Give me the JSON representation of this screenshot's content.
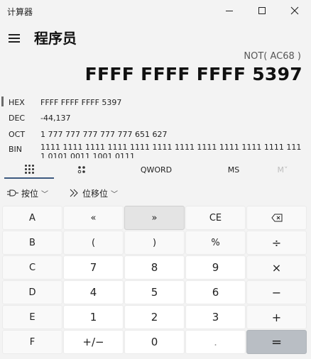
{
  "window": {
    "title": "计算器"
  },
  "header": {
    "mode": "程序员"
  },
  "display": {
    "expression": "NOT( AC68 )",
    "value": "FFFF FFFF FFFF 5397"
  },
  "radix": [
    {
      "label": "HEX",
      "value": "FFFF FFFF FFFF 5397"
    },
    {
      "label": "DEC",
      "value": "-44,137"
    },
    {
      "label": "OCT",
      "value": "1 777 777 777 777 777 651 627"
    },
    {
      "label": "BIN",
      "value": "1111 1111 1111 1111 1111 1111 1111 1111 1111 1111 1111 1111 0101 0011 1001 0111"
    }
  ],
  "tabs": {
    "word_size": "QWORD",
    "memory_store": "MS",
    "memory_add": "M˅"
  },
  "operations": {
    "bitwise": "按位",
    "bit_shift": "位移位"
  },
  "keypad": [
    [
      "A",
      "«",
      "»",
      "CE",
      "⌫"
    ],
    [
      "B",
      "(",
      ")",
      "%",
      "÷"
    ],
    [
      "C",
      "7",
      "8",
      "9",
      "×"
    ],
    [
      "D",
      "4",
      "5",
      "6",
      "−"
    ],
    [
      "E",
      "1",
      "2",
      "3",
      "+"
    ],
    [
      "F",
      "+/−",
      "0",
      ".",
      "="
    ]
  ],
  "icons": {
    "menu": "hamburger-icon",
    "keypad_tab": "keypad-icon",
    "bit_flip_tab": "bit-flip-icon",
    "bitwise": "logic-gate-icon",
    "bit_shift": "shift-icon",
    "chevron": "chevron-down-icon",
    "backspace": "backspace-icon"
  },
  "colors": {
    "background": "#f3f3f3",
    "key": "#f9f9f9",
    "digit_key": "#ffffff",
    "equals_key": "#b9bec4",
    "pressed_key": "#e4e4e4",
    "active_indicator": "#3d5a80"
  }
}
